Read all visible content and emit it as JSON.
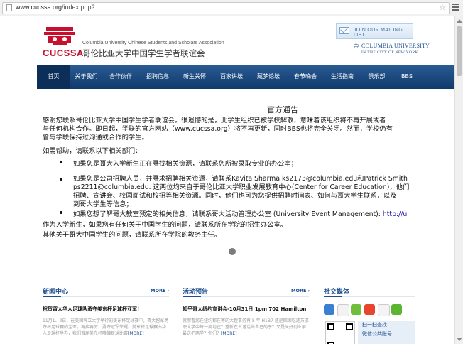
{
  "browser": {
    "url_host": "www.cucssa.org",
    "url_path": "/index.php?"
  },
  "header": {
    "logo_text": "CUCSSA",
    "org_name_en": "Columbia University Chinese Students and Scholars Association",
    "org_name_cn": "哥伦比亚大学中国学生学者联谊会",
    "mailing_label": "JOIN OUR MAILING LIST",
    "columbia_name": "COLUMBIA UNIVERSITY",
    "columbia_sub": "IN THE CITY OF NEW YORK"
  },
  "nav": {
    "items": [
      "首页",
      "关于我们",
      "合作伙伴",
      "招聘信息",
      "新生关怀",
      "百家讲坛",
      "藏梦论坛",
      "春节晚会",
      "生活指南",
      "俱乐部",
      "BBS"
    ]
  },
  "notice": {
    "title": "官方通告",
    "p1_line1": "感谢您联系哥伦比亚大学中国学生学者联谊会。很遗憾的是，此学生组织已被学校解散，意味着该组织将不再开展或者",
    "p1_line2": "与任何机构合作。即日起，学联的官方网站（www.cucssa.org）将不再更新，同时BBS也将完全关闭。然而，学校仍有",
    "p1_line3": "曾与学联保持过沟通或合作的学生。",
    "help": "如需帮助，请联系以下相关部门：",
    "bullet1": "如果您是哥大入学新生正在寻找相关资源，请联系您所被录取专业的办公室；",
    "bullet2_line1": "如果您是公司招聘人员，并寻求招聘相关资源，请联系Kavita Sharma ks2173@columbia.edu和Patrick Smith",
    "bullet2_line2": "ps2211@columbia.edu. 这两位均来自于哥伦比亚大学职业发展教育中心(Center for Career Education)，他们",
    "bullet2_line3": "招聘、宣讲会、校园面试和校招等相关资源。同时，他们也可为您提供招聘时间表、如何与哥大学生联系，以及",
    "bullet2_line4": "到哥大学生等信息；",
    "bullet3_text": "如果您想了解哥大教室预定的相关信息，请联系哥大活动管理办公室 (University Event Management): ",
    "bullet3_link": "http://u",
    "p2_line1": "作为入学新生，如果您有任何关于中国学生的问题，请联系所在学院的招生办公室。",
    "p2_line2": "其他关于哥大中国学生的问题，请联系所在学院的教务主任。"
  },
  "footer": {
    "news_title": "新闻中心",
    "news_more": "MORE",
    "news_headline": "祝贺留大华人足球队勇夺美东杯足球杯亚军！",
    "news_snippet": "11月1、2日，在美国坪立大学举行的美东杯足球赛中，哥大留军勇夺杯足球赛的宝亚，再接再厉，勇夺冠军荣耀。美东杯足球赛由华人足球杯举办，我们首届美东杯哈佛足球比赛",
    "news_readmore": "[MORE]",
    "events_title": "活动预告",
    "events_more": "MORE",
    "events_headline": "知乎哥大纽约宣讲会-10月31日 1pm 702 Hamilton",
    "events_snippet": "就哪看您在纽约都在寄的大趣事务再 8 年 H1B7 还是回国吃还万求职大学中每一周地往？重新在人送话当自己的子？又是关好创业前最送把两学？你们？",
    "events_readmore": "[MORE]",
    "social_title": "社交媒体",
    "wechat_line1": "扫一扫查找",
    "wechat_line2": "微信公共账号"
  }
}
